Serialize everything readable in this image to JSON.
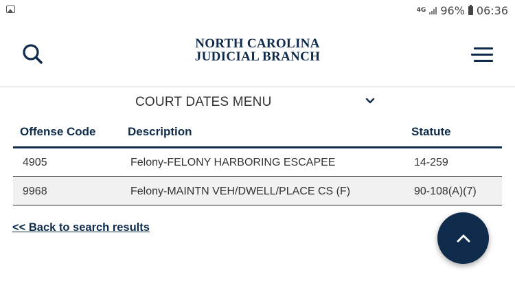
{
  "status_bar": {
    "network": "4G",
    "battery": "96%",
    "time": "06:36",
    "icons": [
      "image-icon",
      "signal-icon",
      "battery-icon"
    ]
  },
  "header": {
    "brand_line1": "NORTH CAROLINA",
    "brand_line2": "JUDICIAL BRANCH",
    "search_icon": "search-icon",
    "menu_icon": "hamburger-menu-icon"
  },
  "court_dates_menu": {
    "label": "COURT DATES MENU",
    "icon": "chevron-down-icon"
  },
  "offense_table": {
    "columns": [
      "Offense Code",
      "Description",
      "Statute"
    ],
    "rows": [
      {
        "code": "4905",
        "description": "Felony-FELONY HARBORING ESCAPEE",
        "statute": "14-259"
      },
      {
        "code": "9968",
        "description": "Felony-MAINTN VEH/DWELL/PLACE CS (F)",
        "statute": "90-108(A)(7)"
      }
    ]
  },
  "back_link": "<< Back to search results",
  "fab": {
    "icon": "chevron-up-icon"
  },
  "colors": {
    "brand_navy": "#0e2b4b",
    "row_alt": "#f1f1f1",
    "text": "#333333"
  }
}
